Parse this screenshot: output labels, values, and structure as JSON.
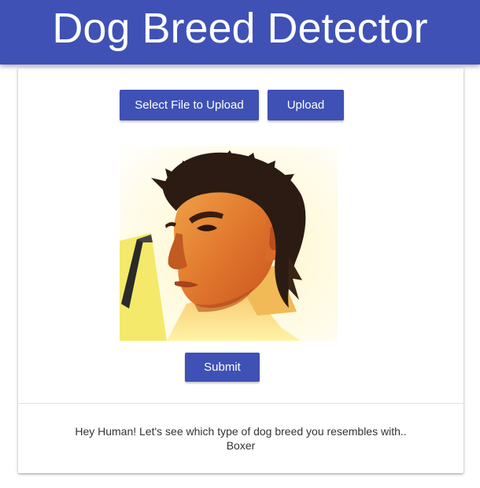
{
  "header": {
    "title": "Dog Breed Detector"
  },
  "actions": {
    "select_file_label": "Select File to Upload",
    "upload_label": "Upload",
    "submit_label": "Submit"
  },
  "preview": {
    "content": "uploaded photo of a young man with spiky hair against a bright yellow background"
  },
  "result": {
    "message": "Hey Human! Let's see which type of dog breed you resembles with..",
    "breed": "Boxer"
  },
  "colors": {
    "primary": "#3f51b5",
    "on_primary": "#ffffff",
    "text": "#333333"
  }
}
